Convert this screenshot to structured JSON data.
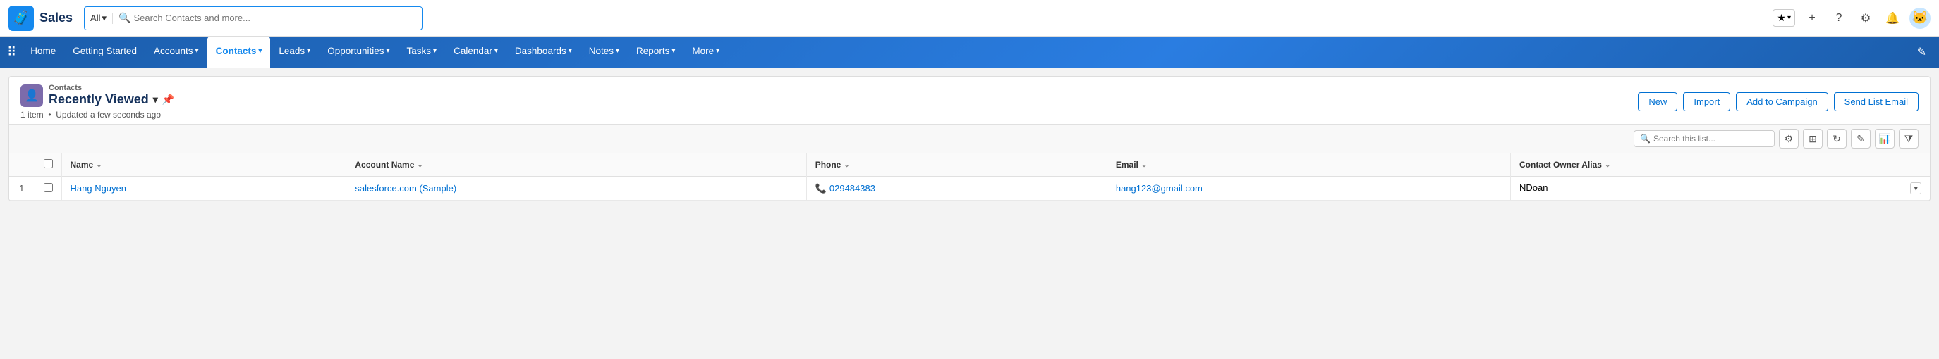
{
  "app": {
    "logo_icon": "🧳",
    "name": "Sales",
    "search_scope": "All",
    "search_placeholder": "Search Contacts and more...",
    "icons": {
      "star": "★",
      "chevron_down": "▾",
      "plus": "+",
      "question": "?",
      "gear": "⚙",
      "bell": "🔔",
      "pencil": "✎"
    }
  },
  "nav": {
    "items": [
      {
        "label": "Home",
        "has_chevron": false,
        "active": false
      },
      {
        "label": "Getting Started",
        "has_chevron": false,
        "active": false
      },
      {
        "label": "Accounts",
        "has_chevron": true,
        "active": false
      },
      {
        "label": "Contacts",
        "has_chevron": true,
        "active": true
      },
      {
        "label": "Leads",
        "has_chevron": true,
        "active": false
      },
      {
        "label": "Opportunities",
        "has_chevron": true,
        "active": false
      },
      {
        "label": "Tasks",
        "has_chevron": true,
        "active": false
      },
      {
        "label": "Calendar",
        "has_chevron": true,
        "active": false
      },
      {
        "label": "Dashboards",
        "has_chevron": true,
        "active": false
      },
      {
        "label": "Notes",
        "has_chevron": true,
        "active": false
      },
      {
        "label": "Reports",
        "has_chevron": true,
        "active": false
      },
      {
        "label": "More",
        "has_chevron": true,
        "active": false
      }
    ]
  },
  "list_view": {
    "breadcrumb": "Contacts",
    "title": "Recently Viewed",
    "item_count": "1 item",
    "updated_text": "Updated a few seconds ago",
    "actions": {
      "new": "New",
      "import": "Import",
      "add_to_campaign": "Add to Campaign",
      "send_list_email": "Send List Email"
    },
    "search_placeholder": "Search this list...",
    "columns": [
      {
        "label": "Name",
        "sortable": true
      },
      {
        "label": "Account Name",
        "sortable": true
      },
      {
        "label": "Phone",
        "sortable": true
      },
      {
        "label": "Email",
        "sortable": true
      },
      {
        "label": "Contact Owner Alias",
        "sortable": true
      }
    ],
    "rows": [
      {
        "row_num": 1,
        "name": "Hang Nguyen",
        "account_name": "salesforce.com (Sample)",
        "phone": "029484383",
        "email": "hang123@gmail.com",
        "owner_alias": "NDoan"
      }
    ]
  }
}
